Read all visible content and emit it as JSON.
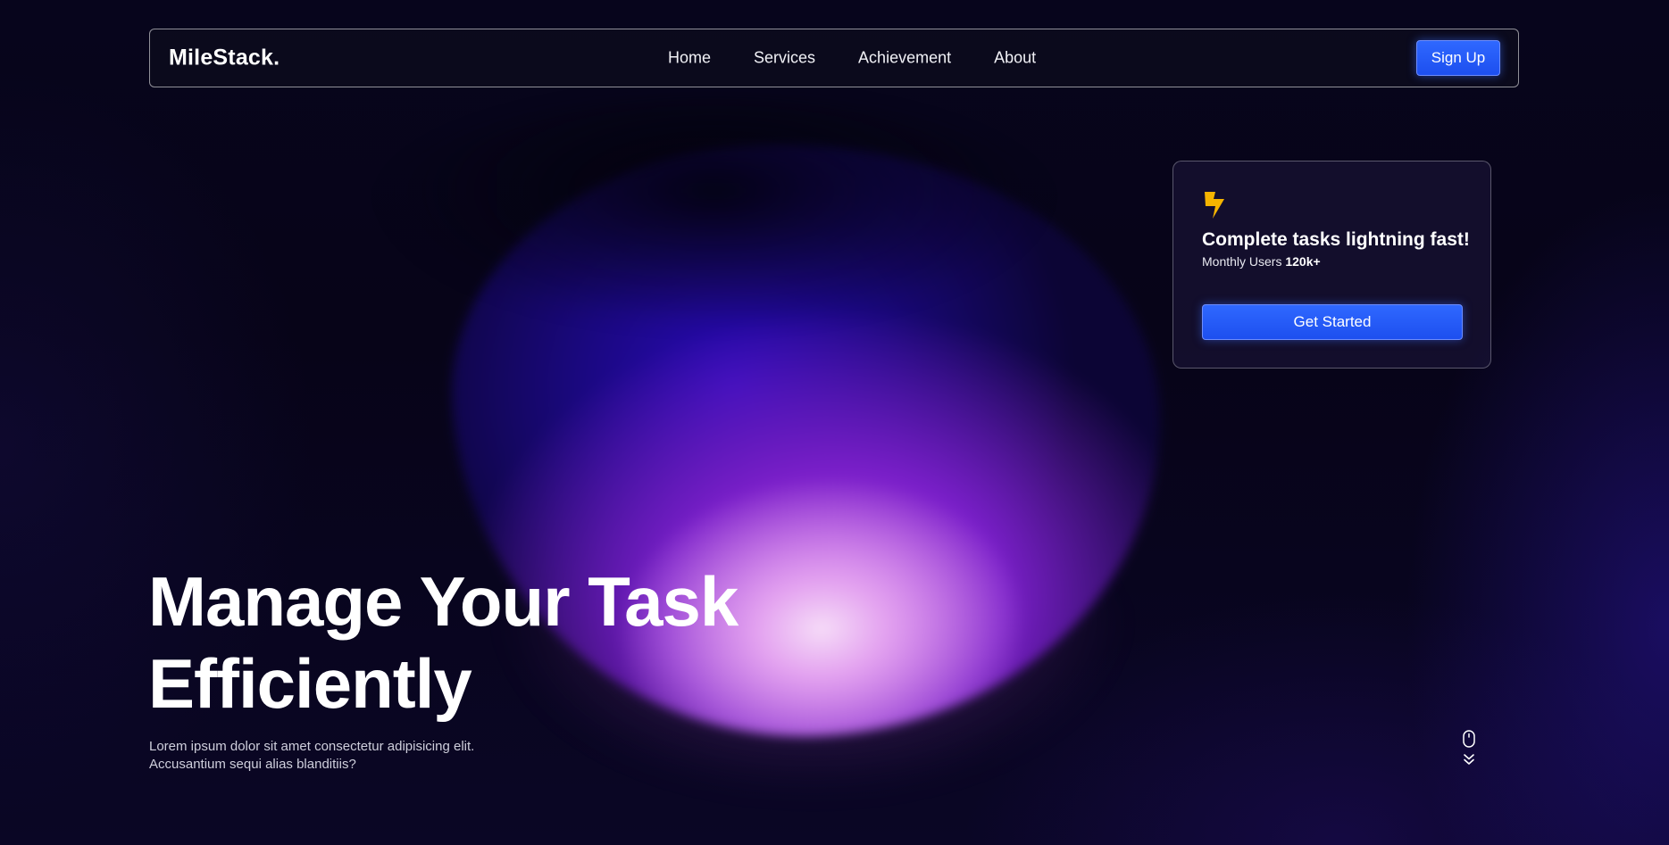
{
  "nav": {
    "logo": "MileStack.",
    "links": [
      "Home",
      "Services",
      "Achievement",
      "About"
    ],
    "signup_label": "Sign Up"
  },
  "card": {
    "icon": "lightning-bolt-icon",
    "icon_color": "#f5b400",
    "title": "Complete tasks lightning fast!",
    "users_label": "Monthly Users",
    "users_value": "120k+",
    "cta_label": "Get Started"
  },
  "hero": {
    "title_line1": "Manage Your Task",
    "title_line2": "Efficiently",
    "description_line1": "Lorem ipsum dolor sit amet consectetur adipisicing elit.",
    "description_line2": "Accusantium sequi alias blanditiis?"
  },
  "scroll_indicator": {
    "icons": [
      "mouse-icon",
      "double-chevron-down-icon"
    ]
  },
  "colors": {
    "accent": "#1d4fef",
    "background": "#06041a",
    "bolt": "#f5b400"
  }
}
